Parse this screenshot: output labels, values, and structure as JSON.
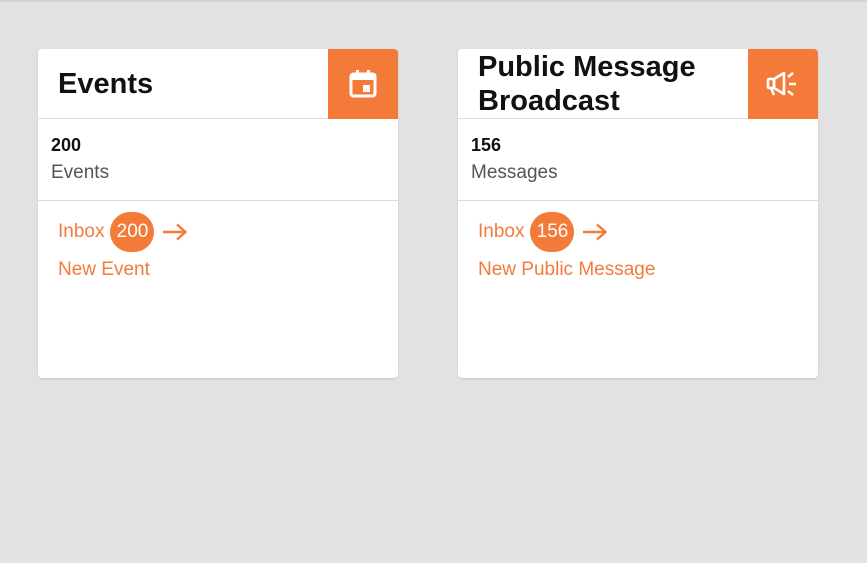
{
  "colors": {
    "accent": "#f47a3a",
    "background": "#e2e2e2",
    "card": "#ffffff"
  },
  "cards": [
    {
      "title": "Events",
      "icon": "calendar-icon",
      "count": "200",
      "count_label": "Events",
      "inbox_label": "Inbox",
      "inbox_badge": "200",
      "new_link": "New Event"
    },
    {
      "title": "Public Message Broadcast",
      "icon": "megaphone-icon",
      "count": "156",
      "count_label": "Messages",
      "inbox_label": "Inbox",
      "inbox_badge": "156",
      "new_link": "New Public Message"
    }
  ]
}
